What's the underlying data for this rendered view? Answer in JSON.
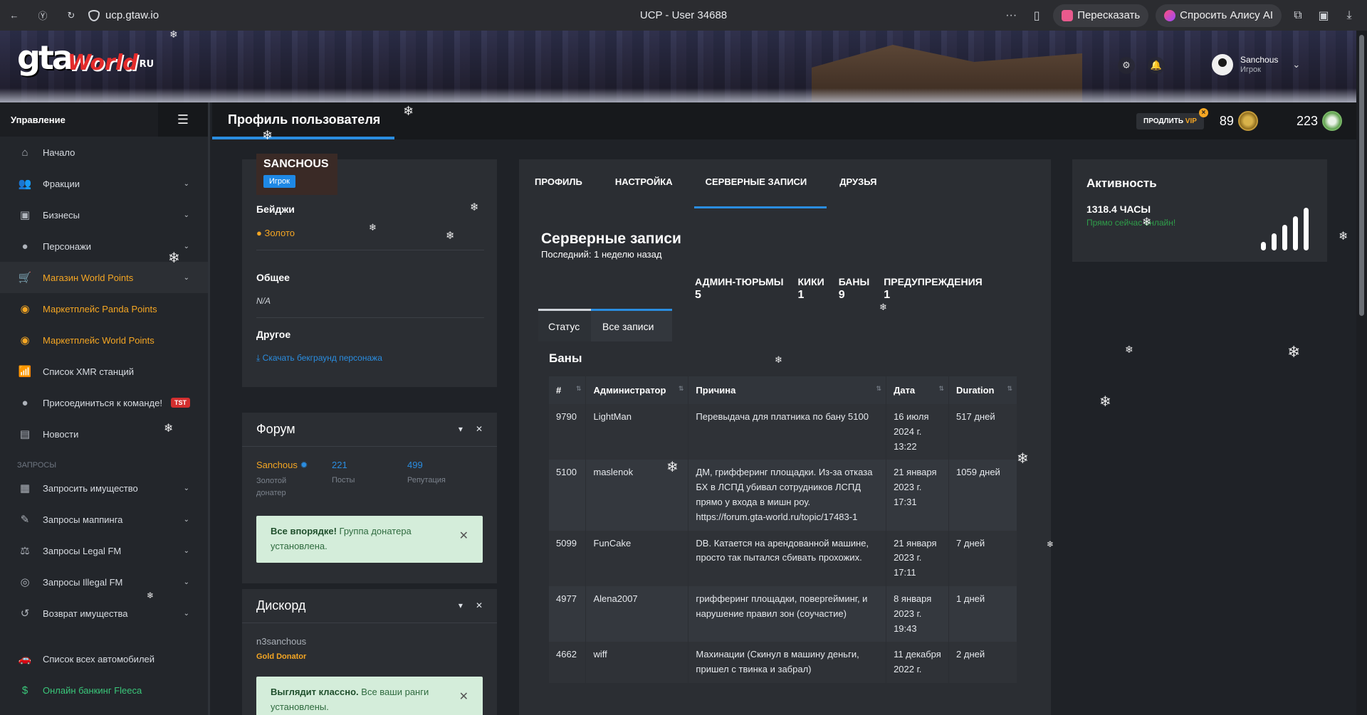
{
  "browser": {
    "url": "ucp.gtaw.io",
    "tab_title": "UCP - User 34688",
    "retell_label": "Пересказать",
    "ask_alice_label": "Спросить Алису AI"
  },
  "banner": {
    "logo_gta": "gta",
    "logo_world": "World",
    "logo_ru": "RU",
    "user_name": "Sanchous",
    "user_role": "Игрок"
  },
  "sidebar": {
    "heading": "Управление",
    "items": [
      {
        "label": "Начало",
        "icon": "home-icon",
        "chev": false
      },
      {
        "label": "Фракции",
        "icon": "users-icon",
        "chev": true
      },
      {
        "label": "Бизнесы",
        "icon": "briefcase-icon",
        "chev": true
      },
      {
        "label": "Персонажи",
        "icon": "person-icon",
        "chev": true
      },
      {
        "label": "Магазин World Points",
        "icon": "cart-icon",
        "chev": true,
        "style": "active"
      },
      {
        "label": "Маркетплейс Panda Points",
        "icon": "coins-icon",
        "style": "orange"
      },
      {
        "label": "Маркетплейс World Points",
        "icon": "coins-icon",
        "style": "orange"
      },
      {
        "label": "Список XMR станций",
        "icon": "antenna-icon"
      },
      {
        "label": "Присоединиться к команде!",
        "icon": "user-plus-icon",
        "badge": "TST"
      },
      {
        "label": "Новости",
        "icon": "newspaper-icon"
      }
    ],
    "section_requests": "ЗАПРОСЫ",
    "request_items": [
      {
        "label": "Запросить имущество",
        "icon": "building-icon",
        "chev": true
      },
      {
        "label": "Запросы маппинга",
        "icon": "brush-icon",
        "chev": true
      },
      {
        "label": "Запросы Legal FM",
        "icon": "scales-icon",
        "chev": true
      },
      {
        "label": "Запросы Illegal FM",
        "icon": "mask-icon",
        "chev": true
      },
      {
        "label": "Возврат имущества",
        "icon": "undo-icon",
        "chev": true
      }
    ],
    "bottom_items": [
      {
        "label": "Список всех автомобилей",
        "icon": "car-icon"
      },
      {
        "label": "Онлайн банкинг Fleeca",
        "icon": "bank-icon",
        "style": "green"
      }
    ]
  },
  "header": {
    "page_title": "Профиль пользователя",
    "vip_label_a": "ПРОДЛИТЬ",
    "vip_label_b": "VIP",
    "points_world": "89",
    "points_panda": "223"
  },
  "profile": {
    "name": "SANCHOUS",
    "rank": "Игрок",
    "badges_title": "Бейджи",
    "badge_gold": "Золото",
    "general_title": "Общее",
    "general_value": "N/A",
    "other_title": "Другое",
    "download_link": "Скачать бекграунд персонажа"
  },
  "forum": {
    "title": "Форум",
    "username": "Sanchous",
    "user_sub": "Золотой донатер",
    "posts_value": "221",
    "posts_label": "Посты",
    "rep_value": "499",
    "rep_label": "Репутация",
    "alert_bold": "Все впорядке!",
    "alert_text": " Группа донатера установлена."
  },
  "discord": {
    "title": "Дискорд",
    "username": "n3sanchous",
    "group": "Gold Donator",
    "alert_bold": "Выглядит классно.",
    "alert_text": " Все ваши ранги установлены."
  },
  "tabs": [
    "ПРОФИЛЬ",
    "НАСТРОЙКА",
    "СЕРВЕРНЫЕ ЗАПИСИ",
    "ДРУЗЬЯ"
  ],
  "records": {
    "title": "Серверные записи",
    "last": "Последний: 1 неделю назад",
    "stats": [
      {
        "label": "АДМИН-ТЮРЬМЫ",
        "value": "5"
      },
      {
        "label": "КИКИ",
        "value": "1"
      },
      {
        "label": "БАНЫ",
        "value": "9"
      },
      {
        "label": "ПРЕДУПРЕЖДЕНИЯ",
        "value": "1"
      }
    ],
    "subtab_status": "Статус",
    "subtab_all": "Все записи",
    "bans_title": "Баны",
    "columns": [
      "#",
      "Администратор",
      "Причина",
      "Дата",
      "Duration"
    ],
    "rows": [
      [
        "9790",
        "LightMan",
        "Перевыдача для платника по бану 5100",
        "16 июля 2024 г. 13:22",
        "517 дней"
      ],
      [
        "5100",
        "maslenok",
        "ДМ, грифферинг площадки. Из-за отказа БХ в ЛСПД убивал сотрудников ЛСПД прямо у входа в мишн роу. https://forum.gta-world.ru/topic/17483-1",
        "21 января 2023 г. 17:31",
        "1059 дней"
      ],
      [
        "5099",
        "FunCake",
        "DB. Катается на арендованной машине, просто так пытался сбивать прохожих.",
        "21 января 2023 г. 17:11",
        "7 дней"
      ],
      [
        "4977",
        "Alena2007",
        "грифферинг площадки, повергейминг, и нарушение правил зон (соучастие)",
        "8 января 2023 г. 19:43",
        "1 дней"
      ],
      [
        "4662",
        "wiff",
        "Махинации (Скинул в машину деньги, пришел с твинка и забрал)",
        "11 декабря 2022 г.",
        "2 дней"
      ]
    ]
  },
  "activity": {
    "title": "Активность",
    "hours": "1318.4 ЧАСЫ",
    "online": "Прямо сейчас онлайн!"
  }
}
